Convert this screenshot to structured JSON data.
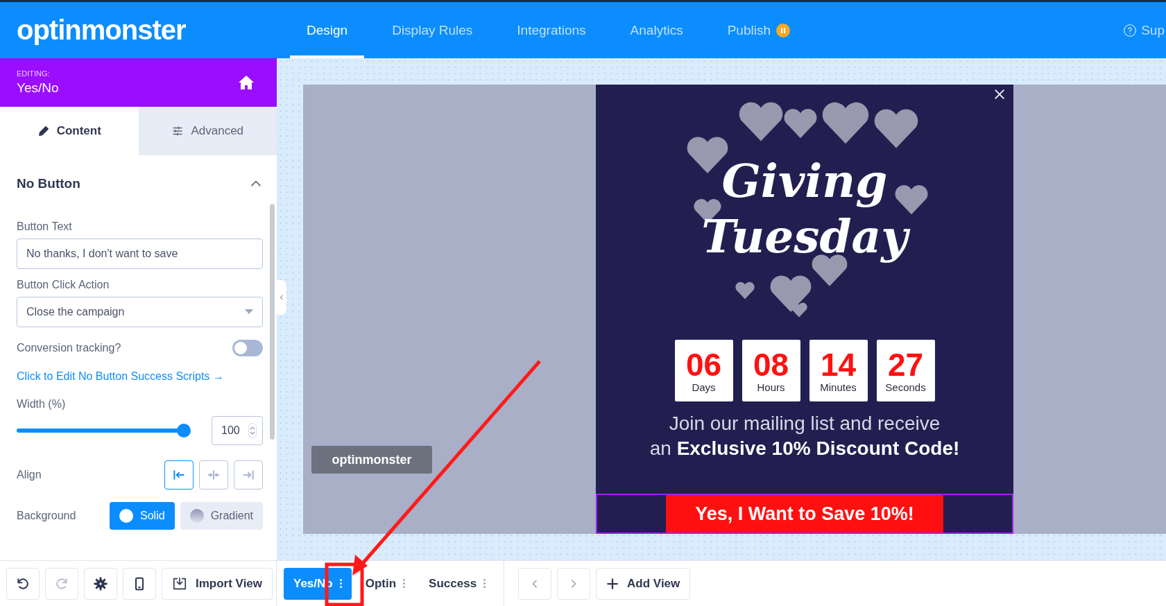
{
  "app_bar": {
    "logo": "optinmonster",
    "nav": [
      {
        "label": "Design",
        "selected": true,
        "badge": false
      },
      {
        "label": "Display Rules",
        "selected": false,
        "badge": false
      },
      {
        "label": "Integrations",
        "selected": false,
        "badge": false
      },
      {
        "label": "Analytics",
        "selected": false,
        "badge": false
      },
      {
        "label": "Publish",
        "selected": false,
        "badge": true
      }
    ],
    "help": "Sup"
  },
  "editing": {
    "caption": "EDITING:",
    "name": "Yes/No"
  },
  "panel_tabs": [
    {
      "label": "Content",
      "kind": "pencil",
      "selected": true
    },
    {
      "label": "Advanced",
      "kind": "sliders",
      "selected": false
    }
  ],
  "section": {
    "title": "No Button",
    "expanded": true
  },
  "button_text": {
    "label": "Button Text",
    "value": "No thanks, I don't want to save"
  },
  "click_action": {
    "label": "Button Click Action",
    "value": "Close the campaign"
  },
  "conversion_tracking": {
    "label": "Conversion tracking?",
    "on": false
  },
  "scripts_link": "Click to Edit No Button Success Scripts →",
  "width": {
    "label": "Width (%)",
    "level": 1,
    "value": "100"
  },
  "align": {
    "label": "Align",
    "options": [
      {
        "kind": "left",
        "selected": true
      },
      {
        "kind": "center",
        "selected": false
      },
      {
        "kind": "right",
        "selected": false
      }
    ]
  },
  "background": {
    "label": "Background",
    "options": [
      {
        "label": "Solid",
        "kind": "solid",
        "selected": true
      },
      {
        "label": "Gradient",
        "kind": "gradient",
        "selected": false
      }
    ]
  },
  "toolbar": {
    "tools": [
      {
        "kind": "undo",
        "disabled": false
      },
      {
        "kind": "redo",
        "disabled": true
      },
      {
        "kind": "settings",
        "disabled": false
      },
      {
        "kind": "mobile",
        "disabled": false
      }
    ],
    "import_button": "Import View",
    "views": [
      {
        "label": "Yes/No",
        "selected": true
      },
      {
        "label": "Optin",
        "selected": false
      },
      {
        "label": "Success",
        "selected": false
      }
    ],
    "add_view": "Add View"
  },
  "canvas": {
    "badge": "optinmonster",
    "popup": {
      "headline": "Giving Tuesday",
      "countdown": [
        {
          "value": "06",
          "unit": "Days"
        },
        {
          "value": "08",
          "unit": "Hours"
        },
        {
          "value": "14",
          "unit": "Minutes"
        },
        {
          "value": "27",
          "unit": "Seconds"
        }
      ],
      "text": "Join our mailing list and receive\nan **Exclusive 10% Discount Code!**",
      "cta": "Yes, I Want to Save 10%!",
      "cta_selected": true
    }
  }
}
